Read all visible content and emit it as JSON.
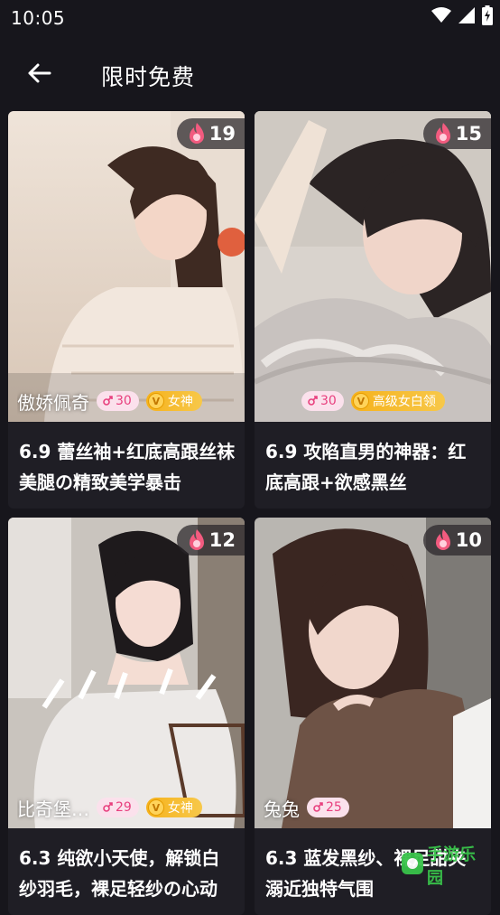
{
  "status_bar": {
    "time": "10:05",
    "icons": [
      "wifi-icon",
      "signal-icon",
      "battery-charging-icon"
    ]
  },
  "app_bar": {
    "back_icon": "arrow-left-icon",
    "title": "限时免费"
  },
  "cards": [
    {
      "heat": "19",
      "author": "傲娇佩奇",
      "level": "30",
      "vip": "女神",
      "title": "6.9 蕾丝袖+红底高跟丝袜美腿の精致美学暴击"
    },
    {
      "heat": "15",
      "author": "",
      "level": "30",
      "vip": "高级女白领",
      "title": "6.9 攻陷直男的神器：红底高跟+欲感黑丝"
    },
    {
      "heat": "12",
      "author": "比奇堡…",
      "level": "29",
      "vip": "女神",
      "title": "6.3 纯欲小天使，解锁白纱羽毛，裸足轻纱の心动"
    },
    {
      "heat": "10",
      "author": "兔兔",
      "level": "25",
      "vip": "",
      "title": "6.3 蓝发黑纱、裸足甜夹溺近独特气围"
    }
  ],
  "watermark": {
    "text": "手游乐园",
    "icon": "watermark-logo-icon"
  },
  "colors": {
    "background": "#17161c",
    "heat_accent": "#f25b7f",
    "level_badge_bg": "#fbe1ec",
    "level_badge_text": "#e8407e",
    "vip_badge": "#f6b21c"
  }
}
